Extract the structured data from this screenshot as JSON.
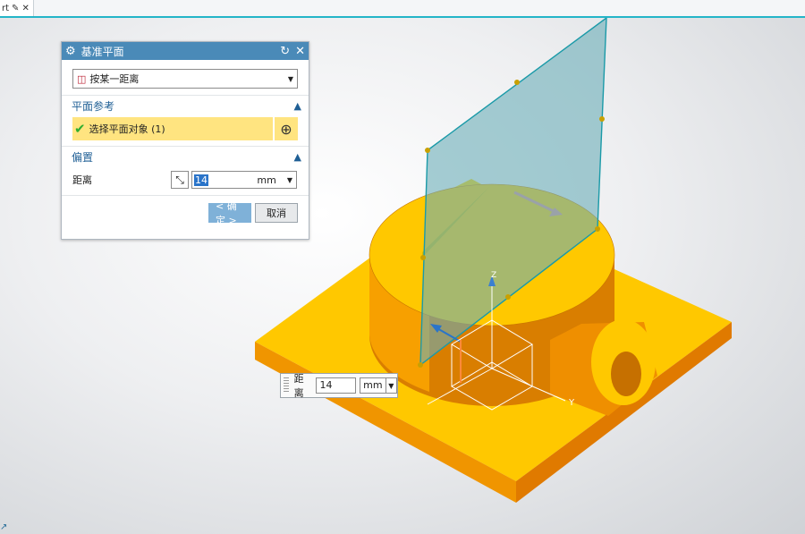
{
  "tab": {
    "label": "rt",
    "edit_icon": "edit-icon",
    "close_icon": "close-icon"
  },
  "dialog": {
    "title": "基准平面",
    "type_select": {
      "value": "按某一距离"
    },
    "plane_ref": {
      "header": "平面参考",
      "select_label": "选择平面对象 (1)"
    },
    "offset": {
      "header": "偏置",
      "distance_label": "距离",
      "distance_value": "14",
      "unit": "mm"
    },
    "ok_label": "< 确定 >",
    "cancel_label": "取消"
  },
  "float_input": {
    "label": "距离",
    "value": "14",
    "unit": "mm"
  },
  "triad": {
    "z_label": "Z",
    "y_label": "Y"
  },
  "colors": {
    "accent": "#23b5c8",
    "title_bar": "#4a8ab8",
    "part": "#ffc800",
    "plane": "#6aaeb8",
    "highlight": "#ffe480"
  }
}
